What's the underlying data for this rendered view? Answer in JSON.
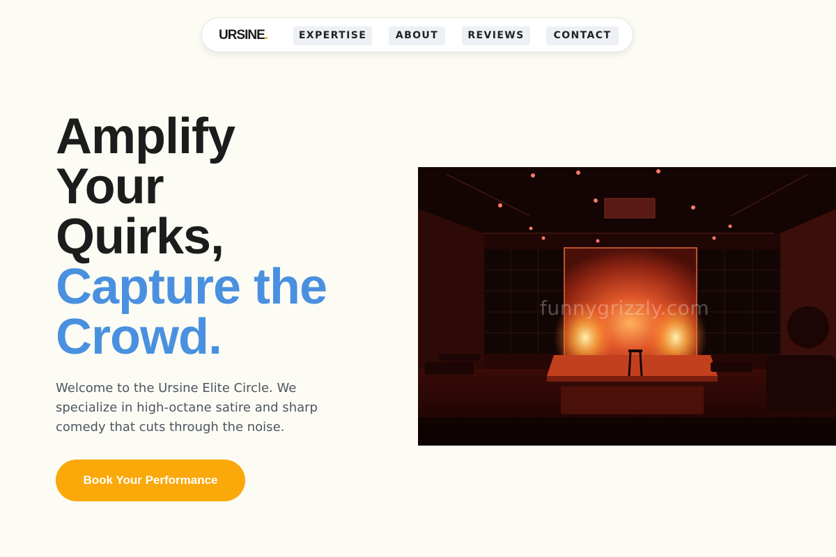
{
  "nav": {
    "logo_text": "URSINE",
    "logo_dot": ".",
    "items": [
      {
        "label": "EXPERTISE"
      },
      {
        "label": "ABOUT"
      },
      {
        "label": "REVIEWS"
      },
      {
        "label": "CONTACT"
      }
    ]
  },
  "hero": {
    "title_lines": [
      "Amplify",
      "Your",
      "Quirks,"
    ],
    "accent_lines": [
      "Capture the",
      "Crowd."
    ],
    "subtitle": "Welcome to the Ursine Elite Circle. We specialize in high-octane satire and sharp comedy that cuts through the noise.",
    "cta_label": "Book Your Performance",
    "image_watermark": "funnygrizzly.com"
  },
  "colors": {
    "background": "#fcfcf4",
    "accent_blue": "#4a90e0",
    "accent_orange": "#fba80a",
    "text_dark": "#1c1c1c",
    "nav_item_bg": "#edf1f5"
  },
  "icons": {
    "stage_image": "comedy-stage-photo"
  }
}
